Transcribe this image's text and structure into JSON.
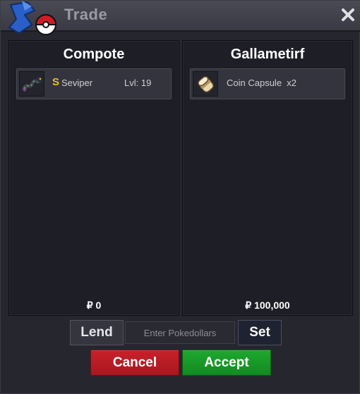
{
  "window": {
    "title": "Trade"
  },
  "left_trader": {
    "name": "Compote",
    "offer_items": [
      {
        "icon": "seviper-sprite-icon",
        "shiny_badge": "S",
        "name": "Seviper",
        "level": "Lvl: 19"
      }
    ],
    "money": "₽ 0"
  },
  "right_trader": {
    "name": "Gallametirf",
    "offer_items": [
      {
        "icon": "coin-capsule-icon",
        "name": "Coin Capsule  x2"
      }
    ],
    "money": "₽ 100,000"
  },
  "controls": {
    "lend_label": "Lend",
    "money_placeholder": "Enter Pokedollars",
    "set_label": "Set",
    "cancel_label": "Cancel",
    "accept_label": "Accept"
  },
  "colors": {
    "cancel": "#b81c24",
    "accept": "#1a9a2a",
    "shiny": "#e8c41c"
  }
}
